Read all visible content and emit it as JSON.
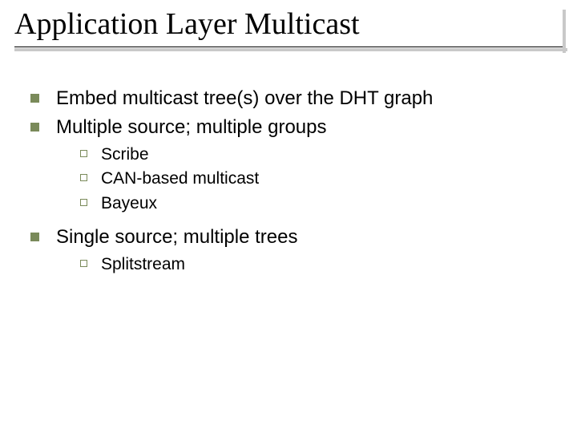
{
  "title": "Application Layer Multicast",
  "bullets": [
    {
      "text": "Embed multicast tree(s) over the DHT graph"
    },
    {
      "text": "Multiple source; multiple groups",
      "sub": [
        "Scribe",
        "CAN-based multicast",
        "Bayeux"
      ]
    },
    {
      "text": "Single source; multiple trees",
      "sub": [
        "Splitstream"
      ]
    }
  ]
}
